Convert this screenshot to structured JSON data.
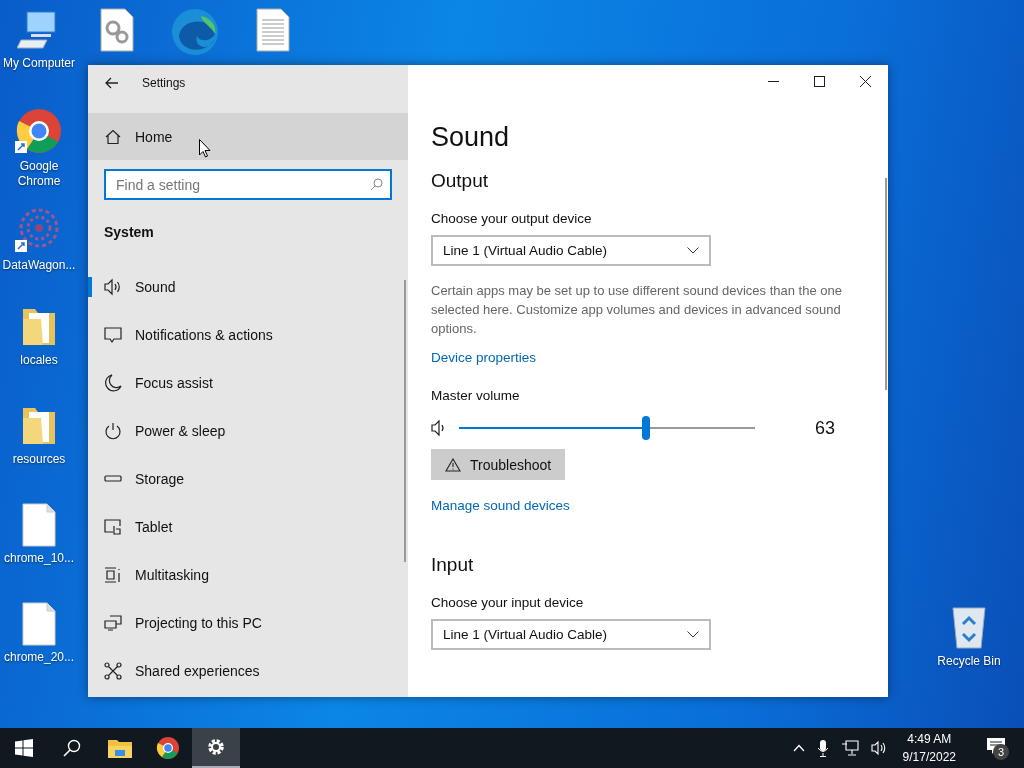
{
  "desktop": {
    "icons": [
      {
        "kind": "computer",
        "label": "My Computer"
      },
      {
        "kind": "settings-file"
      },
      {
        "kind": "edge"
      },
      {
        "kind": "text-file"
      },
      {
        "kind": "chrome",
        "label": "Google Chrome"
      },
      {
        "kind": "datawagon",
        "label": "DataWagon..."
      },
      {
        "kind": "folder",
        "label": "locales"
      },
      {
        "kind": "folder",
        "label": "resources"
      },
      {
        "kind": "file",
        "label": "chrome_10..."
      },
      {
        "kind": "file",
        "label": "chrome_20..."
      },
      {
        "kind": "recycle-bin",
        "label": "Recycle Bin"
      }
    ]
  },
  "window": {
    "title": "Settings",
    "sidebar": {
      "home": {
        "label": "Home",
        "hovered": true
      },
      "search": {
        "placeholder": "Find a setting"
      },
      "section": "System",
      "items": [
        {
          "kind": "sound",
          "label": "Sound",
          "selected": true
        },
        {
          "kind": "notifications",
          "label": "Notifications & actions",
          "selected": false
        },
        {
          "kind": "focus",
          "label": "Focus assist",
          "selected": false
        },
        {
          "kind": "power",
          "label": "Power & sleep",
          "selected": false
        },
        {
          "kind": "storage",
          "label": "Storage",
          "selected": false
        },
        {
          "kind": "tablet",
          "label": "Tablet",
          "selected": false
        },
        {
          "kind": "multitasking",
          "label": "Multitasking",
          "selected": false
        },
        {
          "kind": "projecting",
          "label": "Projecting to this PC",
          "selected": false
        },
        {
          "kind": "shared",
          "label": "Shared experiences",
          "selected": false
        }
      ]
    },
    "page": {
      "title": "Sound",
      "output": {
        "heading": "Output",
        "device_label": "Choose your output device",
        "device": "Line 1 (Virtual Audio Cable)",
        "note": "Certain apps may be set up to use different sound devices than the one selected here. Customize app volumes and devices in advanced sound options.",
        "properties_link": "Device properties",
        "volume_label": "Master volume",
        "volume": {
          "level": 0.63,
          "reading": "63"
        },
        "troubleshoot": "Troubleshoot",
        "manage_link": "Manage sound devices"
      },
      "input": {
        "heading": "Input",
        "device_label": "Choose your input device",
        "device": "Line 1 (Virtual Audio Cable)"
      }
    }
  },
  "taskbar": {
    "apps": [
      {
        "kind": "explorer",
        "active": false
      },
      {
        "kind": "chrome",
        "active": false
      },
      {
        "kind": "settings",
        "active": true
      }
    ],
    "clock": {
      "time": "4:49 AM",
      "date": "9/17/2022"
    },
    "notifications": "3"
  }
}
